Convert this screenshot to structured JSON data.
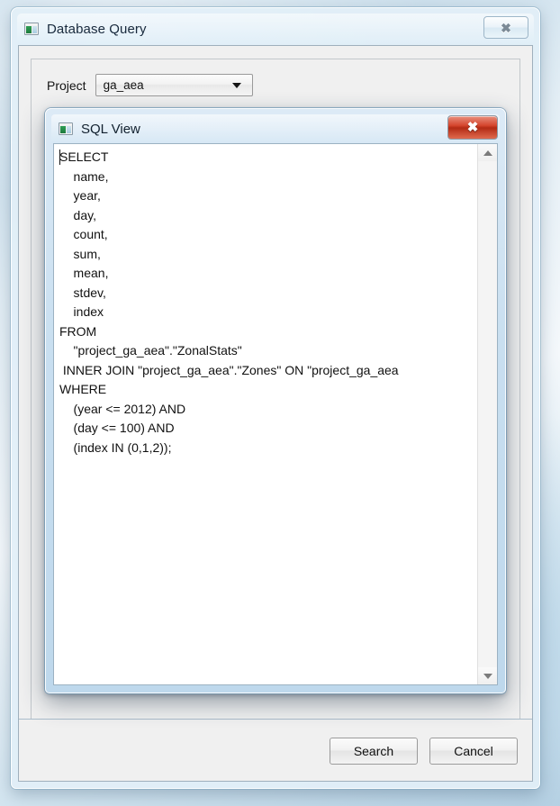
{
  "main_window": {
    "title": "Database Query",
    "icon": "window-app-icon",
    "close_glyph": "✖",
    "project": {
      "label": "Project",
      "value": "ga_aea",
      "arrow_icon": "chevron-down-icon"
    },
    "buttons": {
      "search": "Search",
      "cancel": "Cancel"
    }
  },
  "sql_dialog": {
    "title": "SQL View",
    "icon": "window-app-icon",
    "close_glyph": "✖",
    "close_color": "#c43a20",
    "sql_text": "SELECT\n    name,\n    year,\n    day,\n    count,\n    sum,\n    mean,\n    stdev,\n    index\nFROM\n    \"project_ga_aea\".\"ZonalStats\"\n INNER JOIN \"project_ga_aea\".\"Zones\" ON \"project_ga_aea\nWHERE\n    (year <= 2012) AND\n    (day <= 100) AND\n    (index IN (0,1,2));",
    "scrollbar": {
      "up_icon": "triangle-up-icon",
      "down_icon": "triangle-down-icon"
    }
  }
}
